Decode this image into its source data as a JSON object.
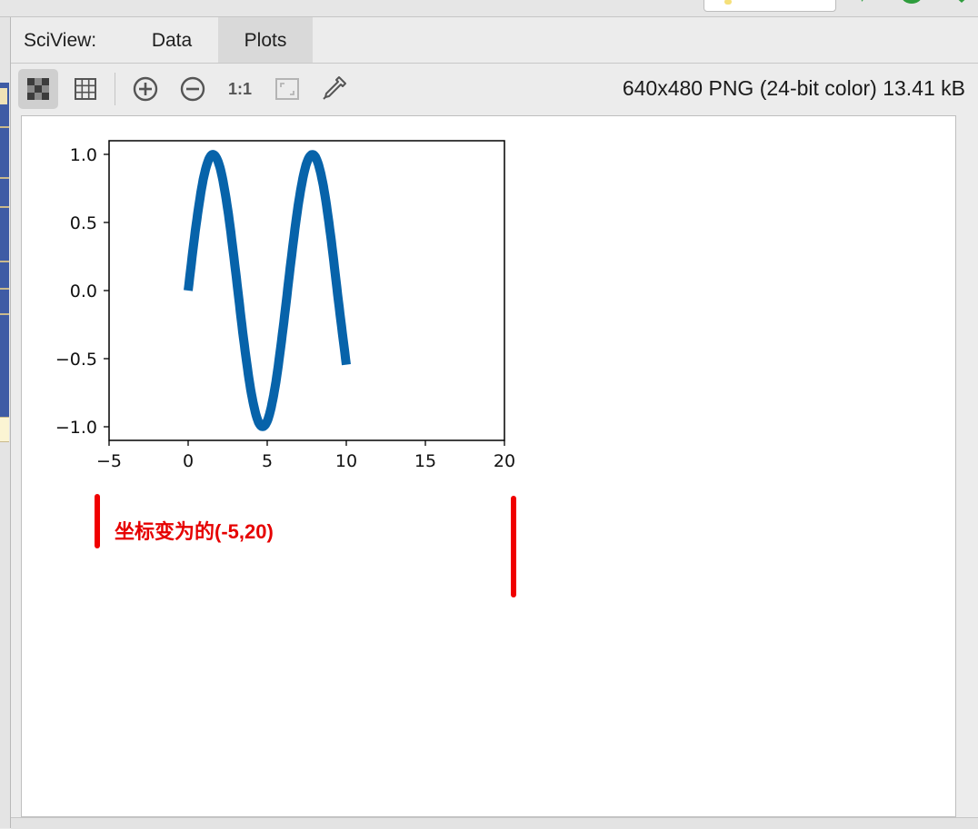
{
  "tabbar": {
    "prefix": "SciView:",
    "tabs": [
      {
        "label": "Data",
        "active": false
      },
      {
        "label": "Plots",
        "active": true
      }
    ]
  },
  "toolbar": {
    "buttons": [
      {
        "icon": "checkerboard-icon",
        "active": true
      },
      {
        "icon": "grid-icon",
        "active": false
      },
      {
        "icon": "zoom-in-icon",
        "active": false
      },
      {
        "icon": "zoom-out-icon",
        "active": false
      },
      {
        "icon": "actual-size-icon",
        "label": "1:1",
        "active": false
      },
      {
        "icon": "fit-to-window-icon",
        "active": false
      },
      {
        "icon": "color-picker-icon",
        "active": false
      }
    ],
    "image_info": "640x480 PNG (24-bit color) 13.41 kB"
  },
  "plot": {
    "annotation": "坐标变为的(-5,20)",
    "colors": {
      "line": "#0763aa",
      "annotation": "#e60000"
    }
  },
  "chart_data": {
    "type": "line",
    "title": "",
    "xlabel": "",
    "ylabel": "",
    "xlim": [
      -5,
      20
    ],
    "ylim": [
      -1.1,
      1.1
    ],
    "xticks": [
      -5,
      0,
      5,
      10,
      15,
      20
    ],
    "yticks": [
      -1.0,
      -0.5,
      0.0,
      0.5,
      1.0
    ],
    "xtick_labels": [
      "−5",
      "0",
      "5",
      "10",
      "15",
      "20"
    ],
    "ytick_labels": [
      "−1.0",
      "−0.5",
      "0.0",
      "0.5",
      "1.0"
    ],
    "grid": false,
    "series": [
      {
        "color": "#0763aa",
        "x": [
          0,
          0.5,
          1,
          1.5,
          2,
          2.5,
          3,
          3.5,
          4,
          4.5,
          5,
          5.5,
          6,
          6.5,
          7,
          7.5,
          8,
          8.5,
          9,
          9.5,
          10
        ],
        "y": [
          0.0,
          0.479,
          0.841,
          0.997,
          0.909,
          0.598,
          0.141,
          -0.351,
          -0.757,
          -0.978,
          -0.959,
          -0.706,
          -0.279,
          0.215,
          0.657,
          0.938,
          0.989,
          0.798,
          0.412,
          -0.075,
          -0.544
        ]
      }
    ]
  }
}
